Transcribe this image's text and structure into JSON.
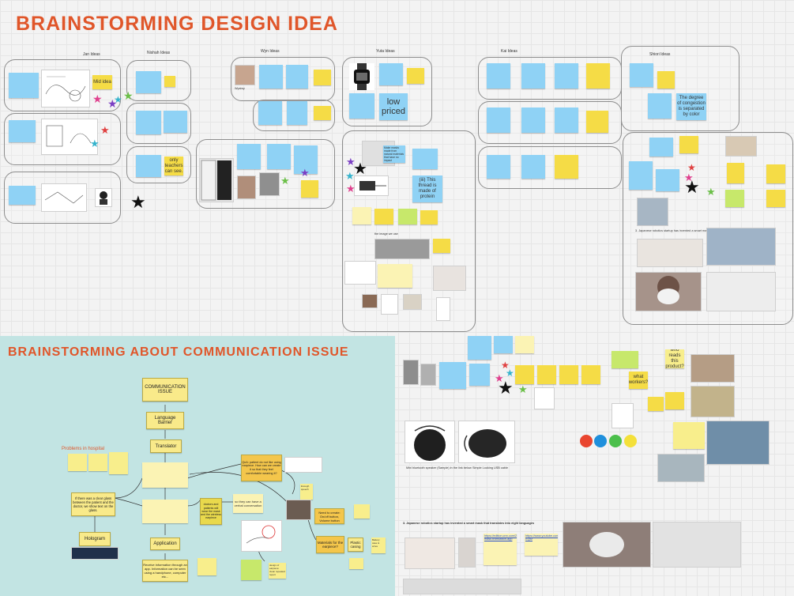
{
  "board": {
    "title_top": "BRAINSTORMING DESIGN IDEA",
    "title_bottom": "BRAINSTORMING ABOUT COMMUNICATION ISSUE"
  },
  "sections": {
    "jan": "Jan Ideas",
    "nishah": "Nishah Ideas",
    "wyn": "Wyn Ideas",
    "yuta": "Yuta Ideas",
    "kai": "Kai Ideas",
    "shiori": "Shiori Ideas"
  },
  "notes": {
    "low_priced": "low priced",
    "only_teachers": "only teachers can see.",
    "this_thread": "(iii) This thread is made of protein",
    "wyn_caption": "Wysiwy",
    "congestion": "The degree of congestion is separated by color",
    "what_workers": "what workers?",
    "who_reads": "who reads this product?",
    "jan_mid": "Mid idea",
    "yuta_image": "the image we use",
    "yuta_big": "Make masks made from natural materials that have no impact"
  },
  "comm": {
    "problems": "Problems in hospital",
    "communication_issue": "COMMUNICATION ISSUE",
    "language_barrier": "Language Barrier",
    "translator": "Translator",
    "application": "Application",
    "hologram": "Hologram",
    "glass_note": "If there was a clear glass between the patient and the doctor, we show text on the glass.",
    "qna": "QnA: patient do not like using earpiece. How can we create it so that they feel comfortable wearing it?",
    "so_they": "so they can have a verbal conversation",
    "need_to_create": "Need to create: On/off button, Volume button",
    "materials": "Materials for the earpiece?",
    "plastic": "Plastic casing",
    "battery": "Battery case & wires",
    "doctors": "doctors and patients will wear the mask and the wireless earpiece",
    "receive": "Receive information through an app. Information can be seen using a handphone, computer etc...",
    "design": "design of earpiece: clean repeated report",
    "enough": "Enough speech"
  },
  "lower_right": {
    "speaker_left": "Mini bluetooth speaker (Sample) in the link below",
    "speaker_right": "Simple Looking USB cable",
    "headline": "3. Japanese robotics startup has invented a smart mask that translates into eight languages",
    "link1": "https://edition.cnn.com/2020/08/05/tech/japan-mask-translation-app",
    "link2": "https://www.youtube.com/watch?v=j9z"
  },
  "colors": {
    "accent": "#e0562a",
    "teal_area": "#c2e4e3",
    "blue_note": "#8fd2f5",
    "yellow_note": "#f5dc46"
  }
}
